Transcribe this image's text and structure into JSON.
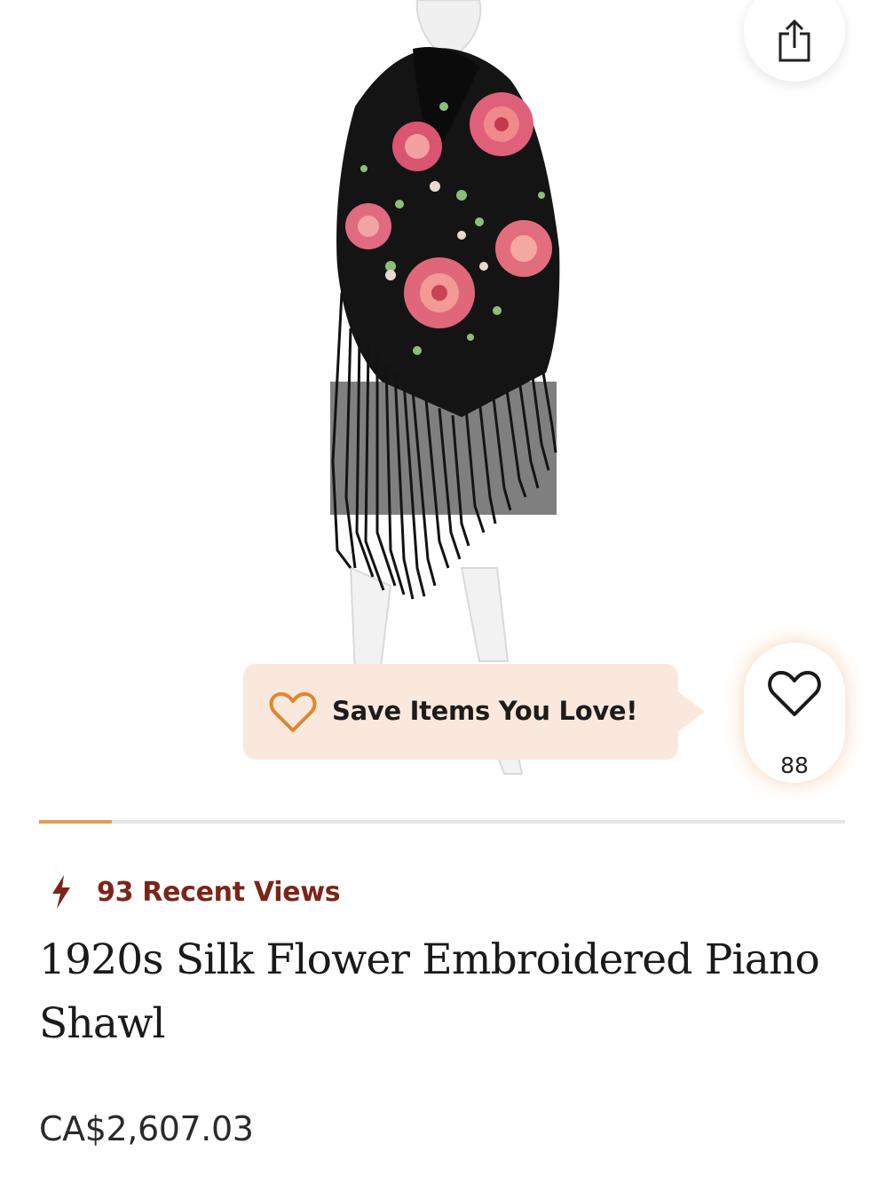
{
  "product": {
    "image_icon": "shawl-on-mannequin-image",
    "title": "1920s Silk Flower Embroidered Piano Shawl",
    "price": "CA$2,607.03",
    "recent_views": "93 Recent Views"
  },
  "actions": {
    "share_icon": "share-icon",
    "favorite_icon": "heart-icon",
    "favorite_count": "88"
  },
  "tooltip": {
    "text": "Save Items You Love!",
    "icon": "heart-outline-icon"
  },
  "carousel": {
    "progress": 0.09
  },
  "colors": {
    "accent": "#e39e4d",
    "views_red": "#7d2418",
    "tooltip_bg": "#fbe8dc"
  }
}
